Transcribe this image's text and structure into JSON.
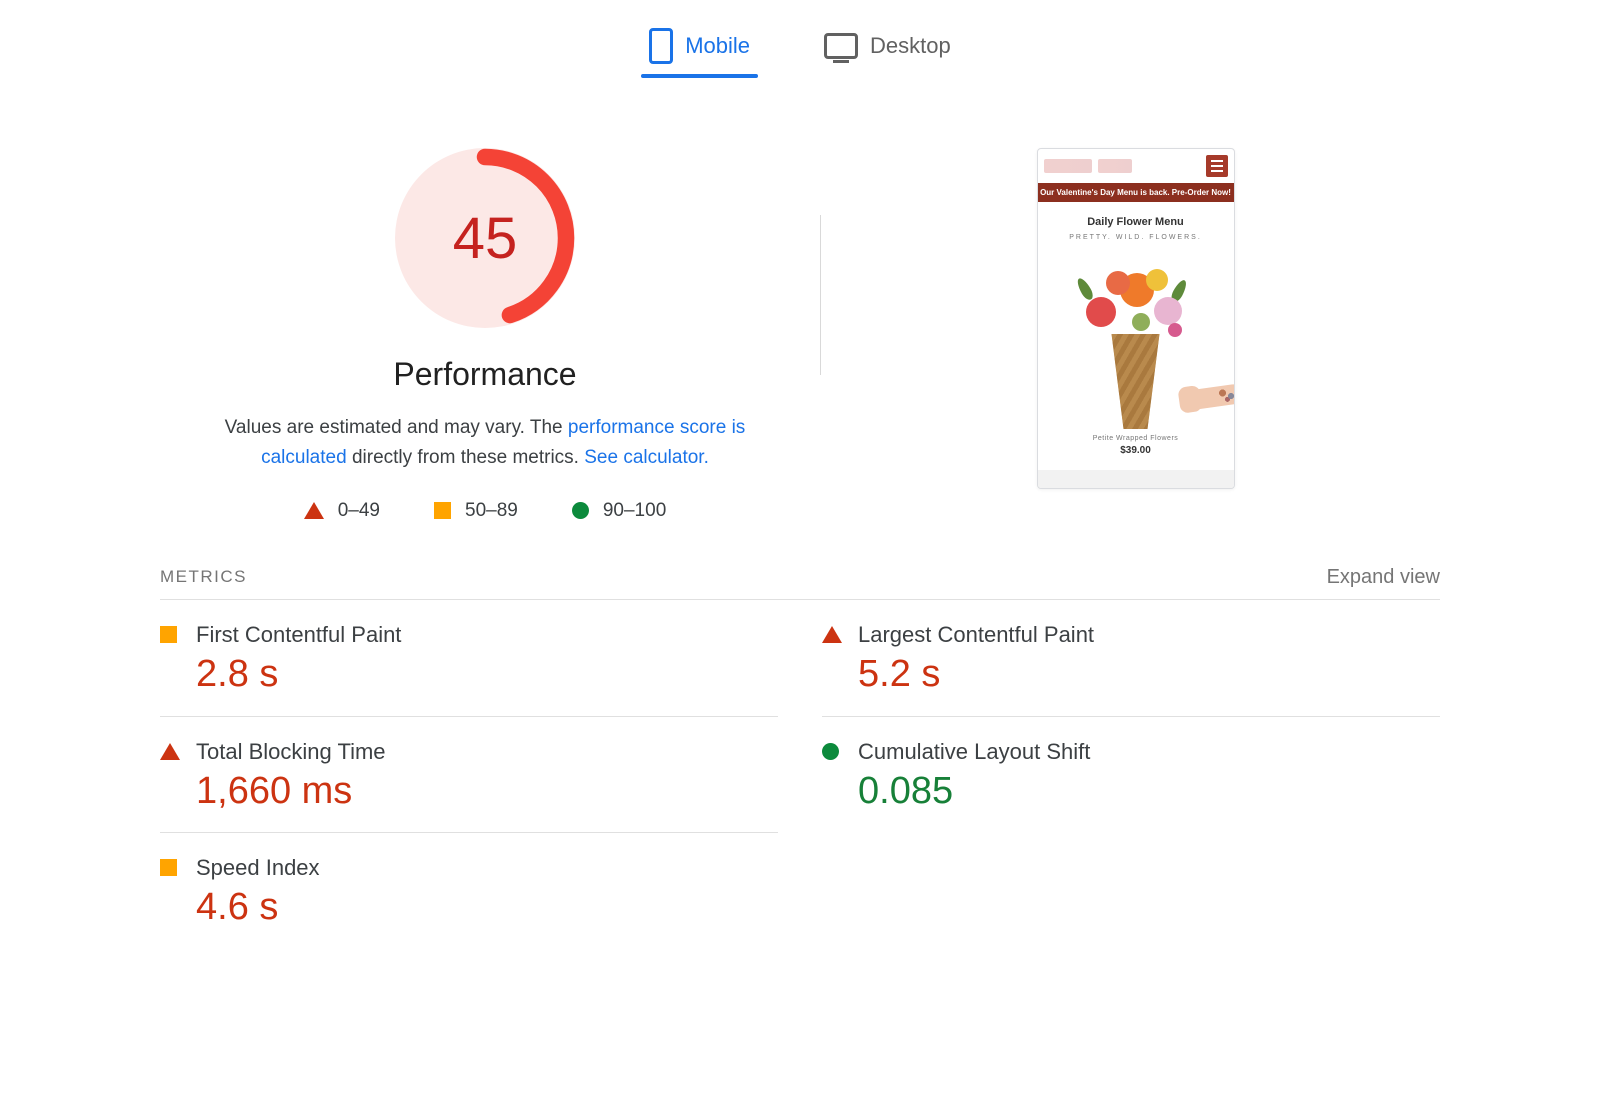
{
  "tabs": {
    "mobile": "Mobile",
    "desktop": "Desktop",
    "active": "mobile"
  },
  "gauge": {
    "score": "45",
    "score_num": 45
  },
  "summary": {
    "title": "Performance",
    "desc_prefix": "Values are estimated and may vary. The ",
    "desc_link1": "performance score is calculated",
    "desc_middle": " directly from these metrics. ",
    "desc_link2": "See calculator."
  },
  "legend": {
    "range_poor": "0–49",
    "range_mid": "50–89",
    "range_good": "90–100"
  },
  "thumbnail": {
    "banner": "Our Valentine's Day Menu is back. Pre-Order Now!",
    "heading": "Daily Flower Menu",
    "subheading": "PRETTY. WILD. FLOWERS.",
    "product_name": "Petite Wrapped Flowers",
    "product_price": "$39.00"
  },
  "metrics_header": {
    "label": "METRICS",
    "expand": "Expand view"
  },
  "metrics": {
    "fcp": {
      "label": "First Contentful Paint",
      "value": "2.8 s",
      "status": "orange"
    },
    "lcp": {
      "label": "Largest Contentful Paint",
      "value": "5.2 s",
      "status": "red"
    },
    "tbt": {
      "label": "Total Blocking Time",
      "value": "1,660 ms",
      "status": "red"
    },
    "cls": {
      "label": "Cumulative Layout Shift",
      "value": "0.085",
      "status": "green"
    },
    "si": {
      "label": "Speed Index",
      "value": "4.6 s",
      "status": "orange"
    }
  },
  "chart_data": {
    "type": "bar",
    "title": "Performance",
    "categories": [
      "First Contentful Paint",
      "Largest Contentful Paint",
      "Total Blocking Time",
      "Cumulative Layout Shift",
      "Speed Index"
    ],
    "series": [
      {
        "name": "value",
        "values": [
          "2.8 s",
          "5.2 s",
          "1,660 ms",
          "0.085",
          "4.6 s"
        ]
      },
      {
        "name": "status",
        "values": [
          "orange",
          "red",
          "red",
          "green",
          "orange"
        ]
      }
    ],
    "overall_score": 45,
    "score_bands": {
      "poor": "0–49",
      "average": "50–89",
      "good": "90–100"
    }
  }
}
